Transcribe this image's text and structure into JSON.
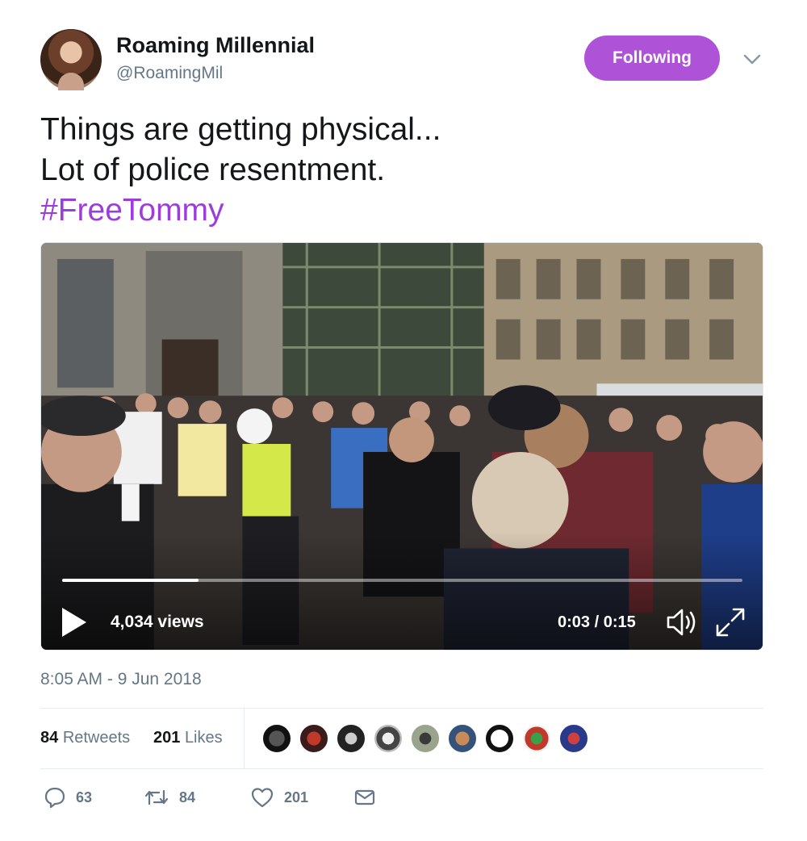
{
  "author": {
    "name": "Roaming Millennial",
    "handle": "@RoamingMil"
  },
  "follow_button": {
    "label": "Following",
    "color": "#ae53d8"
  },
  "menu_icon": "chevron-down-icon",
  "tweet": {
    "lines": [
      "Things are getting physical...",
      "Lot of police resentment."
    ],
    "hashtag": "#FreeTommy",
    "hashtag_color": "#9b3ddb"
  },
  "video": {
    "views": "4,034 views",
    "time": "0:03 / 0:15",
    "progress": 0.2,
    "icons": [
      "play-icon",
      "volume-icon",
      "fullscreen-icon"
    ]
  },
  "timestamp": "8:05 AM - 9 Jun 2018",
  "stats": {
    "retweets_count": "84",
    "retweets_label": "Retweets",
    "likes_count": "201",
    "likes_label": "Likes",
    "liker_avatar_count": 9
  },
  "actions": {
    "reply_count": "63",
    "retweet_count": "84",
    "like_count": "201",
    "icons": [
      "reply-icon",
      "retweet-icon",
      "heart-icon",
      "envelope-icon"
    ]
  }
}
